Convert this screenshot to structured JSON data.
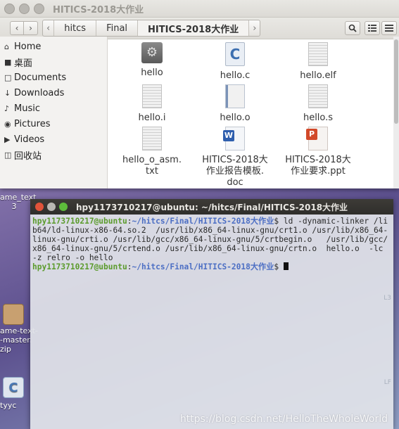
{
  "desktop": {
    "items": [
      {
        "label": "ame_text\n3"
      },
      {
        "label": "ame-text-\n-master.\nzip"
      },
      {
        "label": "tyyc"
      }
    ]
  },
  "file_manager": {
    "title": "HITICS-2018大作业",
    "breadcrumbs": [
      "hitcs",
      "Final",
      "HITICS-2018大作业"
    ],
    "sidebar": [
      {
        "label": "Home",
        "icon": "home-icon"
      },
      {
        "label": "桌面",
        "icon": "folder-icon"
      },
      {
        "label": "Documents",
        "icon": "document-icon"
      },
      {
        "label": "Downloads",
        "icon": "download-icon"
      },
      {
        "label": "Music",
        "icon": "music-icon"
      },
      {
        "label": "Pictures",
        "icon": "camera-icon"
      },
      {
        "label": "Videos",
        "icon": "video-icon"
      },
      {
        "label": "回收站",
        "icon": "trash-icon"
      }
    ],
    "files": [
      {
        "name": "hello",
        "icon": "executable-icon"
      },
      {
        "name": "hello.c",
        "icon": "c-source-icon"
      },
      {
        "name": "hello.elf",
        "icon": "text-file-icon"
      },
      {
        "name": "hello.i",
        "icon": "text-file-icon"
      },
      {
        "name": "hello.o",
        "icon": "object-file-icon"
      },
      {
        "name": "hello.s",
        "icon": "text-file-icon"
      },
      {
        "name": "hello_o_asm.\ntxt",
        "icon": "text-file-icon"
      },
      {
        "name": "HITICS-2018大\n作业报告模板.\ndoc",
        "icon": "word-doc-icon"
      },
      {
        "name": "HITICS-2018大\n作业要求.ppt",
        "icon": "powerpoint-icon"
      }
    ]
  },
  "terminal": {
    "title": "hpy1173710217@ubuntu: ~/hitcs/Final/HITICS-2018大作业",
    "prompt_user": "hpy1173710217@ubuntu",
    "prompt_sep": ":",
    "prompt_path": "~/hitcs/Final/HITICS-2018大作业",
    "prompt_end": "$ ",
    "command": "ld -dynamic-linker /lib64/ld-linux-x86-64.so.2  /usr/lib/x86_64-linux-gnu/crt1.o /usr/lib/x86_64-linux-gnu/crti.o /usr/lib/gcc/x86_64-linux-gnu/5/crtbegin.o   /usr/lib/gcc/x86_64-linux-gnu/5/crtend.o /usr/lib/x86_64-linux-gnu/crtn.o  hello.o  -lc     -z relro -o hello",
    "side_marks": [
      "L3",
      "LF"
    ]
  },
  "watermark": "https://blog.csdn.net/HelloTheWholeWorld",
  "colors": {
    "prompt_user": "#5b9b2c",
    "prompt_path": "#4d6fc4",
    "close": "#e0533a",
    "minimize": "#f5b826",
    "maximize": "#5dbb3b"
  }
}
